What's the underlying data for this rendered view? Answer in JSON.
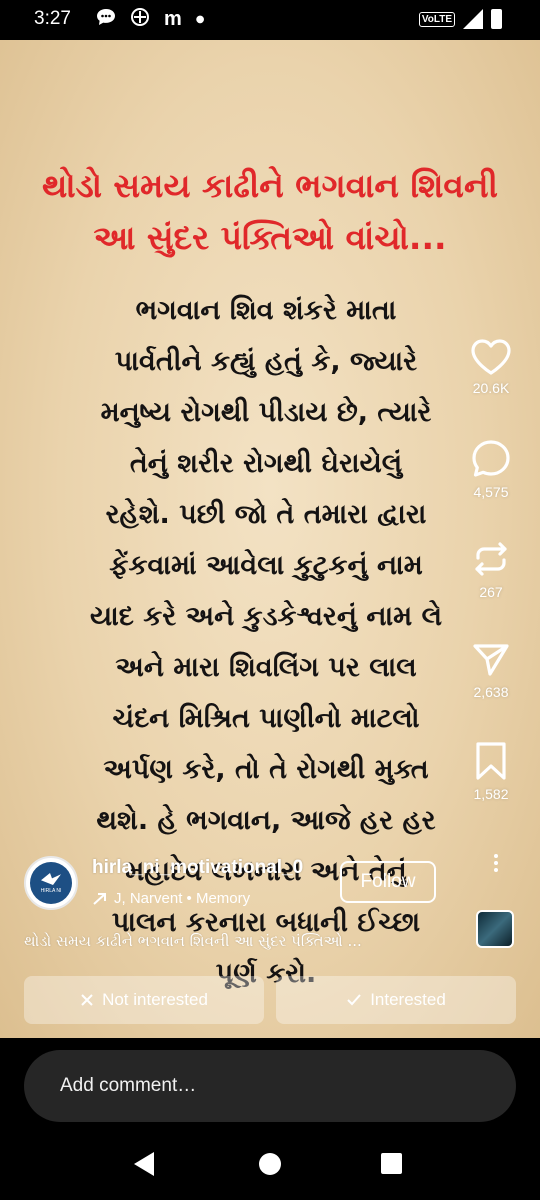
{
  "status_bar": {
    "time": "3:27",
    "volte": "VoLTE",
    "network": "4G"
  },
  "post": {
    "headline_lines": [
      "થોડો સમય કાઢીને ભગવાન શિવની",
      "આ સુંદર પંક્તિઓ વાંચો..."
    ],
    "body_lines": [
      "ભગવાન શિવ શંકરે માતા",
      "પાર્વતીને કહ્યું હતું કે, જ્યારે",
      "મનુષ્ય રોગથી પીડાય છે, ત્યારે",
      "તેનું શરીર રોગથી ઘેરાયેલું",
      "રહેશે. પછી જો તે તમારા દ્વારા",
      "ફેંકવામાં આવેલા કુટુકનું નામ",
      "યાદ કરે અને કુડકેશ્વરનું નામ લે",
      "અને મારા શિવલિંગ પર લાલ",
      "ચંદન મિશ્રિત પાણીનો માટલો",
      "અર્પણ કરે, તો તે રોગથી મુક્ત",
      "થશે. હે ભગવાન, આજે હર હર",
      "મહાદેવ લખનારા અને તેનું",
      "પાલન કરનારા બધાની ઈચ્છા",
      "પૂર્ણ કરો."
    ]
  },
  "actions": {
    "likes": "20.6K",
    "comments": "4,575",
    "reposts": "267",
    "shares": "2,638",
    "saves": "1,582"
  },
  "author": {
    "username": "hirla_ni_motivational_0",
    "audio": "J, Narvent • Memory",
    "follow_label": "Follow",
    "avatar_text": "HIRLA NI"
  },
  "caption": "થોડો સમય કાઢીને ભગવાન શિવની આ સુંદર પંક્તિઓ ...",
  "feedback": {
    "not_interested": "Not interested",
    "interested": "Interested"
  },
  "comment": {
    "placeholder": "Add comment…"
  },
  "icons": {
    "like": "heart-icon",
    "comment": "comment-bubble-icon",
    "repost": "repost-icon",
    "share": "send-icon",
    "save": "bookmark-icon"
  }
}
